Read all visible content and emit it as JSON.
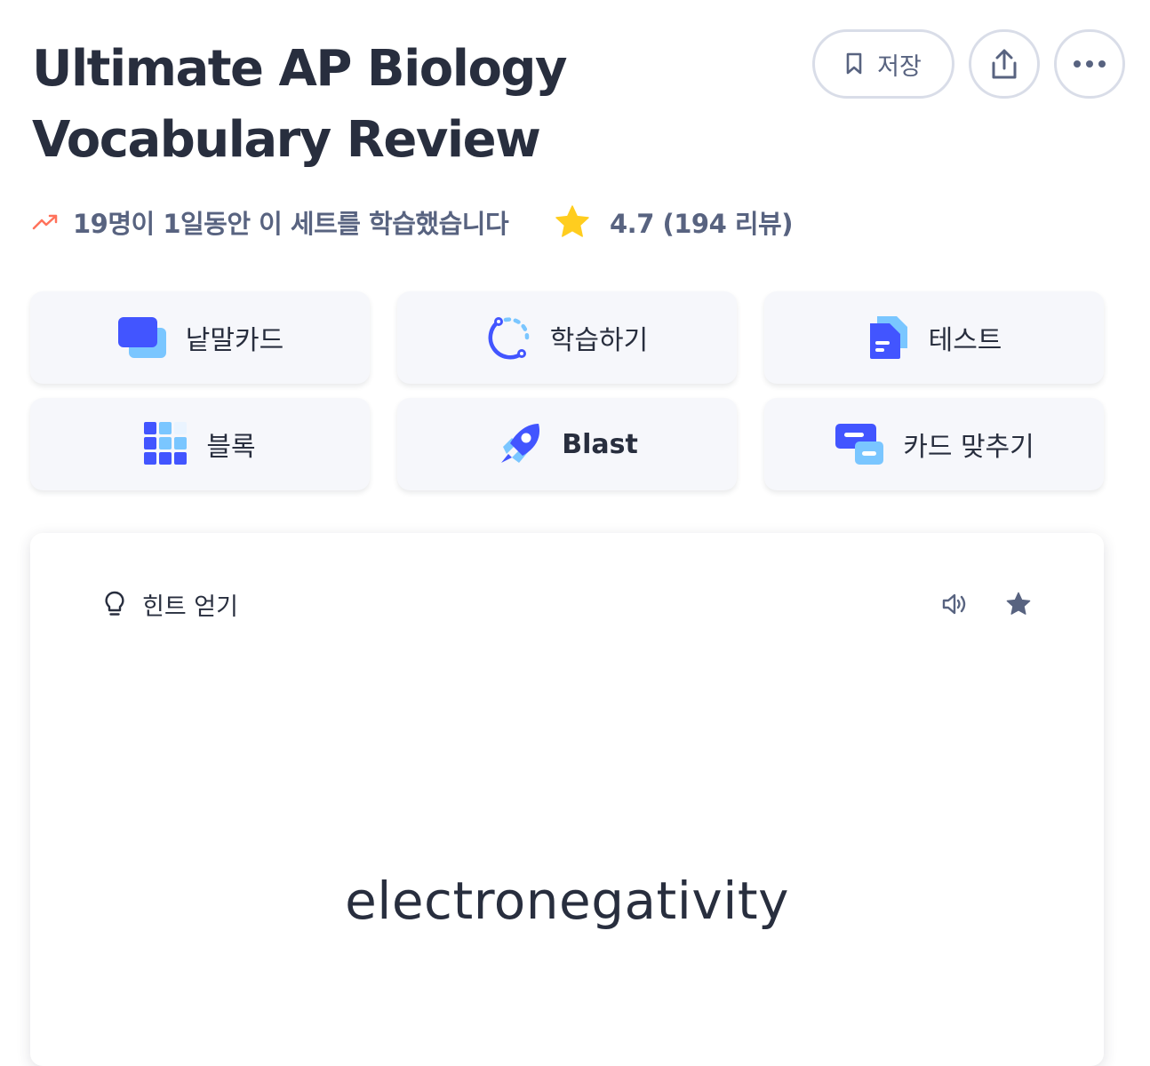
{
  "set": {
    "title_line1": "Ultimate AP Biology",
    "title_line2": "Vocabulary Review",
    "save_label": "저장",
    "trend_text": "19명이 1일동안 이 세트를 학습했습니다",
    "rating_text": "4.7 (194 리뷰)"
  },
  "modes": [
    {
      "label": "낱말카드",
      "icon": "flashcards-icon"
    },
    {
      "label": "학습하기",
      "icon": "learn-icon"
    },
    {
      "label": "테스트",
      "icon": "test-icon"
    },
    {
      "label": "블록",
      "icon": "blocks-icon"
    },
    {
      "label": "Blast",
      "icon": "rocket-icon"
    },
    {
      "label": "카드 맞추기",
      "icon": "match-icon"
    }
  ],
  "card": {
    "hint_label": "힌트 얻기",
    "term": "electronegativity"
  },
  "colors": {
    "text": "#282e3e",
    "muted": "#586380",
    "accent": "#4255ff",
    "accent_light": "#7ac6ff",
    "star": "#ffcd1f",
    "trend": "#ff725b",
    "surface": "#f6f7fb"
  }
}
